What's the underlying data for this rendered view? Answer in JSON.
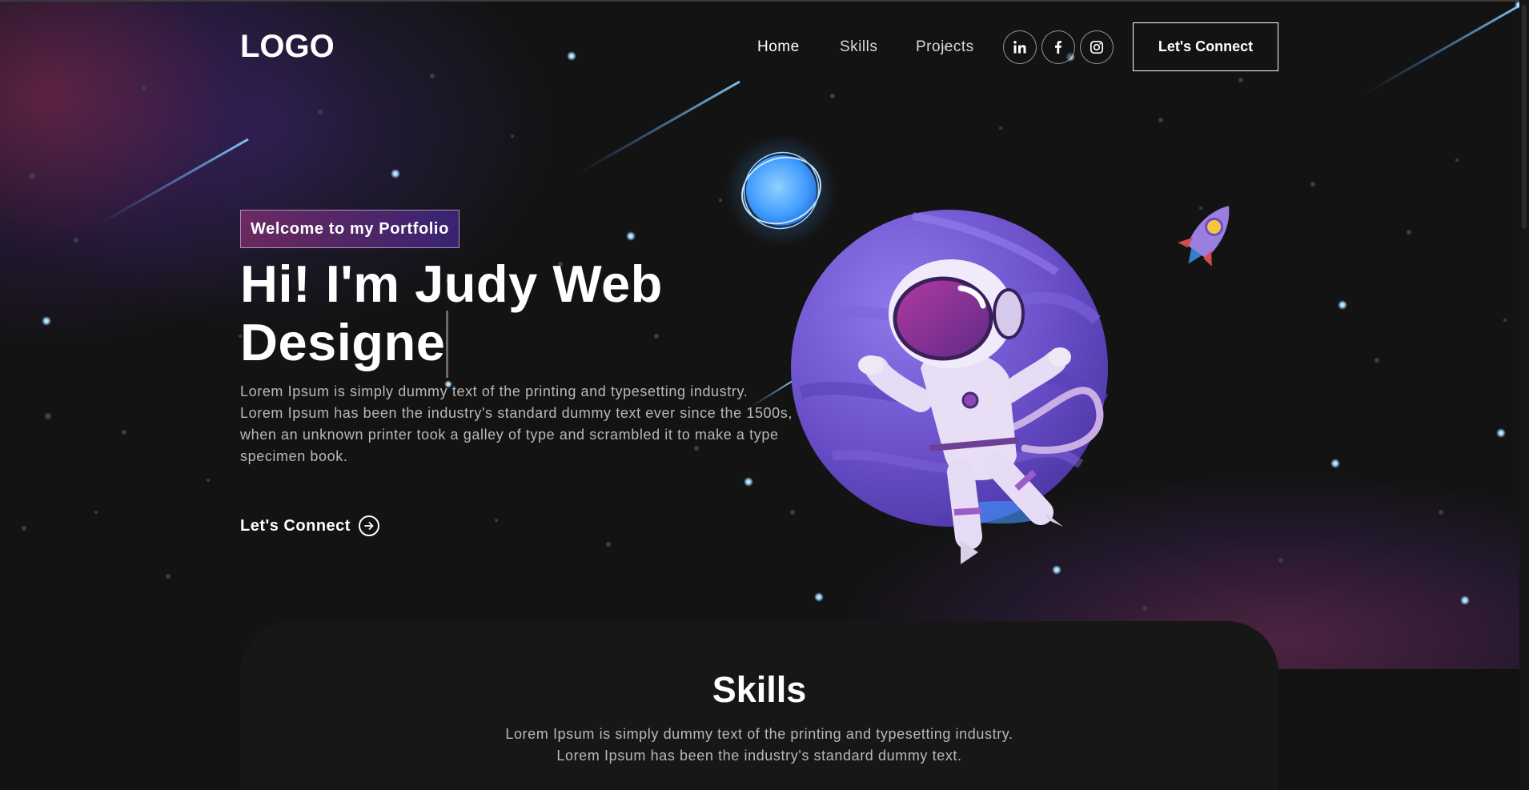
{
  "nav": {
    "logo": "LOGO",
    "links": [
      {
        "label": "Home",
        "active": true
      },
      {
        "label": "Skills",
        "active": false
      },
      {
        "label": "Projects",
        "active": false
      }
    ],
    "social_icons": [
      "linkedin-icon",
      "facebook-icon",
      "instagram-icon"
    ],
    "cta_label": "Let's Connect"
  },
  "hero": {
    "tagline": "Welcome to my Portfolio",
    "title_line1": "Hi! I'm Judy Web",
    "title_line2": "Designe",
    "text": "Lorem Ipsum is simply dummy text of the printing and typesetting industry. Lorem Ipsum has been the industry's standard dummy text ever since the 1500s, when an unknown printer took a galley of type and scrambled it to make a type specimen book.",
    "cta_label": "Let's Connect",
    "cta_icon": "arrow-right-circle-icon",
    "illustration": "astronaut-planet-illustration"
  },
  "skills": {
    "title": "Skills",
    "text_line1": "Lorem Ipsum is simply dummy text of the printing and typesetting industry.",
    "text_line2": "Lorem Ipsum has been the industry's standard dummy text."
  },
  "colors": {
    "background": "#121212",
    "tagline_gradient_start": "#AA367C",
    "tagline_gradient_end": "#4A2FBD",
    "planet": "#6a4fc9",
    "star_glow": "#9fd8ff"
  }
}
